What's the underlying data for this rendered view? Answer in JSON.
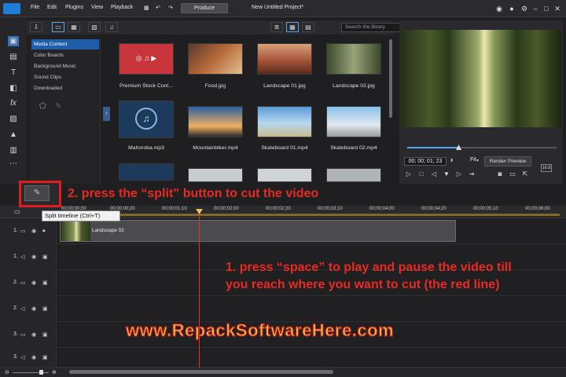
{
  "menu": {
    "items": [
      "File",
      "Edit",
      "Plugins",
      "View",
      "Playback"
    ],
    "produce_label": "Produce",
    "project_title": "New Untitled Project*"
  },
  "library": {
    "search_placeholder": "Search the library",
    "categories": [
      "Media Content",
      "Color Boards",
      "Background Music",
      "Sound Clips",
      "Downloaded"
    ],
    "tiles": [
      {
        "label": "Premium Stock Cont..."
      },
      {
        "label": "Food.jpg"
      },
      {
        "label": "Landscape 01.jpg"
      },
      {
        "label": "Landscape 02.jpg"
      },
      {
        "label": "Mahoroba.mp3"
      },
      {
        "label": "Mountainbiker.mp4"
      },
      {
        "label": "Skateboard 01.mp4"
      },
      {
        "label": "Skateboard 02.mp4"
      }
    ]
  },
  "preview": {
    "timecode": "00; 00; 01; 23",
    "fit_label": "Fit",
    "render_label": "Render Preview",
    "aspect": "16:9"
  },
  "timeline": {
    "ruler": [
      "00;00;00;00",
      "00;00;00;20",
      "00;00;01;10",
      "00;00;02;00",
      "00;00;02;20",
      "00;00;03;10",
      "00;00;04;00",
      "00;00;04;20",
      "00;00;05;10",
      "00;00;06;00"
    ],
    "tracks": [
      "1.",
      "1.",
      "2.",
      "2.",
      "3.",
      "3."
    ],
    "clip_label": "Landscape 02"
  },
  "tooltip": "Split timeline (Ctrl+T)",
  "annotations": {
    "step2": "2. press the “split” button to cut the video",
    "step1": "1. press “space” to play and pause the video till you reach where you want to cut (the red line)",
    "watermark": "www.RepackSoftwareHere.com"
  },
  "colors": {
    "accent": "#1e5ea8",
    "annotation": "#ea2a22",
    "playhead": "#e0322a",
    "watermark": "#f8c24a"
  }
}
